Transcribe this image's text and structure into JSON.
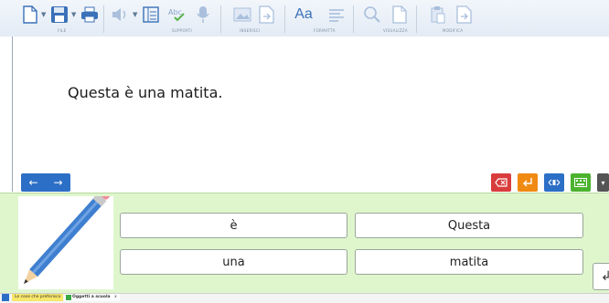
{
  "toolbar": {
    "groups": [
      {
        "label": "FILE"
      },
      {
        "label": "SUPPORTI"
      },
      {
        "label": "INSERISCI"
      },
      {
        "label": "FORMATTA"
      },
      {
        "label": "VISUALIZZA"
      },
      {
        "label": "MODIFICA"
      }
    ],
    "font_button": "Aa"
  },
  "document": {
    "sentence": "Questa è una matita."
  },
  "word_chips": [
    "è",
    "Questa",
    "una",
    "matita"
  ],
  "image": {
    "icon": "pencil-icon"
  },
  "status_bar": {
    "tab_1": "Le cose che preferisco",
    "tab_2": "Oggetti a scuola",
    "tab_2_close": "x"
  },
  "colors": {
    "accent_blue": "#2c6fc6",
    "red_button": "#d93c3c",
    "orange_button": "#f08a12",
    "keyboard_button": "#4cb32f",
    "panel_green": "#dff6cd"
  }
}
